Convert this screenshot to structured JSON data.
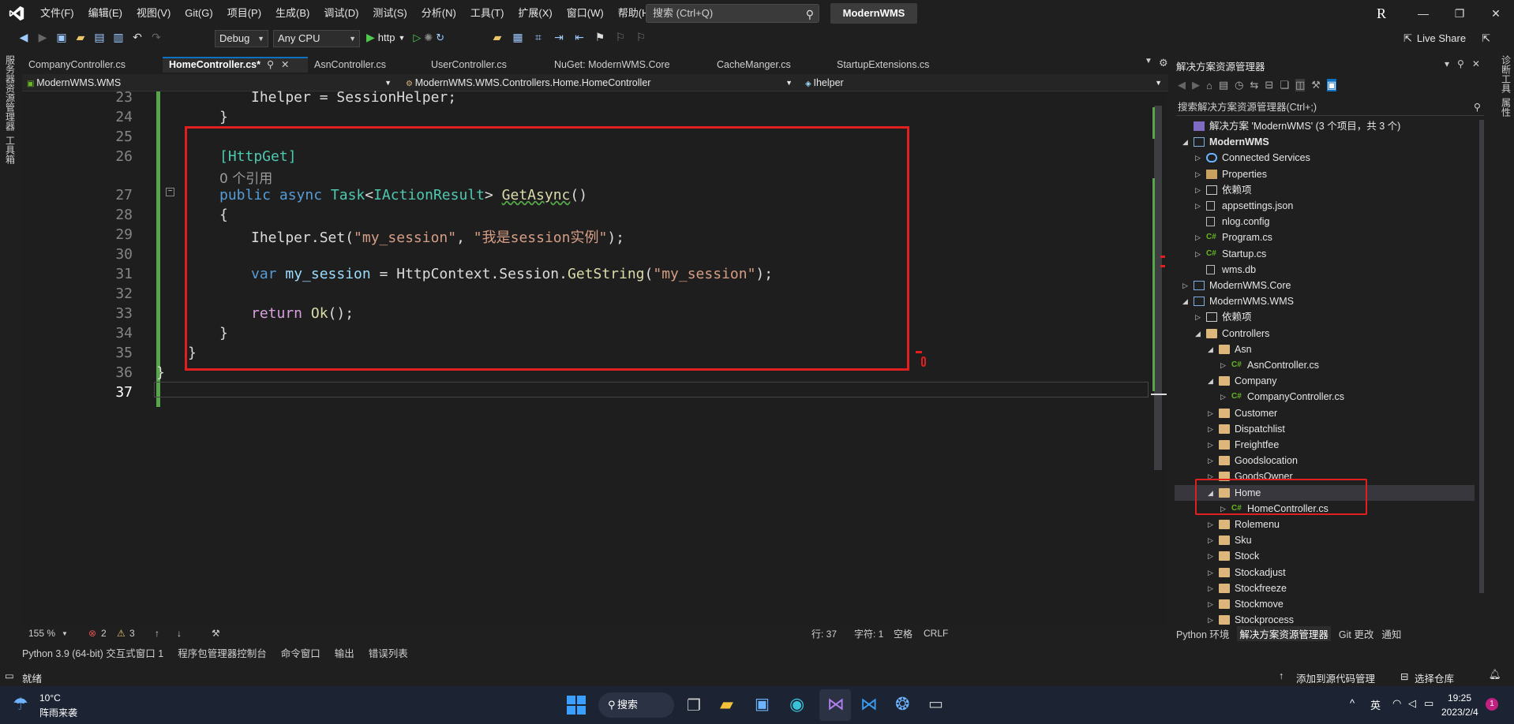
{
  "titlebar": {
    "menu": [
      "文件(F)",
      "编辑(E)",
      "视图(V)",
      "Git(G)",
      "项目(P)",
      "生成(B)",
      "调试(D)",
      "测试(S)",
      "分析(N)",
      "工具(T)",
      "扩展(X)",
      "窗口(W)",
      "帮助(H)"
    ],
    "search_placeholder": "搜索 (Ctrl+Q)",
    "solution_name": "ModernWMS",
    "avatar_letter": "R"
  },
  "toolbar": {
    "config": "Debug",
    "platform": "Any CPU",
    "run_target": "http",
    "live_share": "Live Share"
  },
  "left_strip": [
    "服务器资源管理器",
    "工具箱"
  ],
  "right_strip": [
    "诊断工具",
    "属性"
  ],
  "editor_tabs": [
    {
      "label": "CompanyController.cs",
      "active": false
    },
    {
      "label": "HomeController.cs*",
      "active": true
    },
    {
      "label": "AsnController.cs",
      "active": false
    },
    {
      "label": "UserController.cs",
      "active": false
    },
    {
      "label": "NuGet: ModernWMS.Core",
      "active": false
    },
    {
      "label": "CacheManger.cs",
      "active": false
    },
    {
      "label": "StartupExtensions.cs",
      "active": false
    }
  ],
  "navbar": {
    "project": "ModernWMS.WMS",
    "class": "ModernWMS.WMS.Controllers.Home.HomeController",
    "member": "Ihelper"
  },
  "code": {
    "line_numbers": [
      "23",
      "24",
      "25",
      "26",
      "",
      "27",
      "28",
      "29",
      "30",
      "31",
      "32",
      "33",
      "34",
      "35",
      "36",
      "37"
    ],
    "l23": "Ihelper = SessionHelper;",
    "l24": "}",
    "l26": "[HttpGet]",
    "refs": "0 个引用",
    "l27_kw": "public async ",
    "l27_type": "Task",
    "l27_lt": "<",
    "l27_itype": "IActionResult",
    "l27_gt": "> ",
    "l27_method": "GetAsync",
    "l27_paren": "()",
    "l28": "{",
    "l29_a": "Ihelper.Set(",
    "l29_s1": "\"my_session\"",
    "l29_c": ", ",
    "l29_s2": "\"我是session实例\"",
    "l29_e": ");",
    "l31_kw": "var ",
    "l31_var": "my_session",
    "l31_mid": " = HttpContext.Session.",
    "l31_m": "GetString",
    "l31_p": "(",
    "l31_s": "\"my_session\"",
    "l31_e": ");",
    "l33_kw": "return ",
    "l33_m": "Ok",
    "l33_e": "();",
    "l34": "}",
    "l35": "}",
    "l36": "}"
  },
  "editor_status": {
    "zoom": "155 %",
    "errors": "2",
    "warnings": "3",
    "line": "行: 37",
    "col": "字符: 1",
    "ws": "空格",
    "eol": "CRLF"
  },
  "bottom_tabs": [
    "Python 3.9 (64-bit) 交互式窗口 1",
    "程序包管理器控制台",
    "命令窗口",
    "输出",
    "错误列表"
  ],
  "statusbar": {
    "ready": "就绪",
    "source_control": "添加到源代码管理",
    "repo": "选择仓库"
  },
  "solution_explorer": {
    "title": "解决方案资源管理器",
    "search_placeholder": "搜索解决方案资源管理器(Ctrl+;)",
    "tree": [
      {
        "label": "解决方案 'ModernWMS' (3 个项目，共 3 个)",
        "level": 0,
        "arrow": "",
        "icon": "sln"
      },
      {
        "label": "ModernWMS",
        "level": 0,
        "arrow": "◢",
        "icon": "proj",
        "bold": true
      },
      {
        "label": "Connected Services",
        "level": 1,
        "arrow": "▷",
        "icon": "svc"
      },
      {
        "label": "Properties",
        "level": 1,
        "arrow": "▷",
        "icon": "prop"
      },
      {
        "label": "依赖项",
        "level": 1,
        "arrow": "▷",
        "icon": "dep"
      },
      {
        "label": "appsettings.json",
        "level": 1,
        "arrow": "▷",
        "icon": "file"
      },
      {
        "label": "nlog.config",
        "level": 1,
        "arrow": "",
        "icon": "file"
      },
      {
        "label": "Program.cs",
        "level": 1,
        "arrow": "▷",
        "icon": "cs"
      },
      {
        "label": "Startup.cs",
        "level": 1,
        "arrow": "▷",
        "icon": "cs"
      },
      {
        "label": "wms.db",
        "level": 1,
        "arrow": "",
        "icon": "file"
      },
      {
        "label": "ModernWMS.Core",
        "level": 0,
        "arrow": "▷",
        "icon": "proj"
      },
      {
        "label": "ModernWMS.WMS",
        "level": 0,
        "arrow": "◢",
        "icon": "proj"
      },
      {
        "label": "依赖项",
        "level": 1,
        "arrow": "▷",
        "icon": "dep"
      },
      {
        "label": "Controllers",
        "level": 1,
        "arrow": "◢",
        "icon": "folder"
      },
      {
        "label": "Asn",
        "level": 2,
        "arrow": "◢",
        "icon": "folder"
      },
      {
        "label": "AsnController.cs",
        "level": 3,
        "arrow": "▷",
        "icon": "cs"
      },
      {
        "label": "Company",
        "level": 2,
        "arrow": "◢",
        "icon": "folder"
      },
      {
        "label": "CompanyController.cs",
        "level": 3,
        "arrow": "▷",
        "icon": "cs"
      },
      {
        "label": "Customer",
        "level": 2,
        "arrow": "▷",
        "icon": "folder"
      },
      {
        "label": "Dispatchlist",
        "level": 2,
        "arrow": "▷",
        "icon": "folder"
      },
      {
        "label": "Freightfee",
        "level": 2,
        "arrow": "▷",
        "icon": "folder"
      },
      {
        "label": "Goodslocation",
        "level": 2,
        "arrow": "▷",
        "icon": "folder"
      },
      {
        "label": "GoodsOwner",
        "level": 2,
        "arrow": "▷",
        "icon": "folder"
      },
      {
        "label": "Home",
        "level": 2,
        "arrow": "◢",
        "icon": "folder",
        "selected": true
      },
      {
        "label": "HomeController.cs",
        "level": 3,
        "arrow": "▷",
        "icon": "cs"
      },
      {
        "label": "Rolemenu",
        "level": 2,
        "arrow": "▷",
        "icon": "folder"
      },
      {
        "label": "Sku",
        "level": 2,
        "arrow": "▷",
        "icon": "folder"
      },
      {
        "label": "Stock",
        "level": 2,
        "arrow": "▷",
        "icon": "folder"
      },
      {
        "label": "Stockadjust",
        "level": 2,
        "arrow": "▷",
        "icon": "folder"
      },
      {
        "label": "Stockfreeze",
        "level": 2,
        "arrow": "▷",
        "icon": "folder"
      },
      {
        "label": "Stockmove",
        "level": 2,
        "arrow": "▷",
        "icon": "folder"
      },
      {
        "label": "Stockprocess",
        "level": 2,
        "arrow": "▷",
        "icon": "folder"
      }
    ],
    "bottom_tabs": [
      "Python 环境",
      "解决方案资源管理器",
      "Git 更改",
      "通知"
    ]
  },
  "taskbar": {
    "weather_temp": "10°C",
    "weather_desc": "阵雨来袭",
    "search": "搜索",
    "ime": "英",
    "time": "19:25",
    "date": "2023/2/4",
    "notif": "1"
  },
  "colors": {
    "accent": "#0e70c0",
    "highlight_red": "#e02020",
    "change_green": "#57a64a"
  }
}
